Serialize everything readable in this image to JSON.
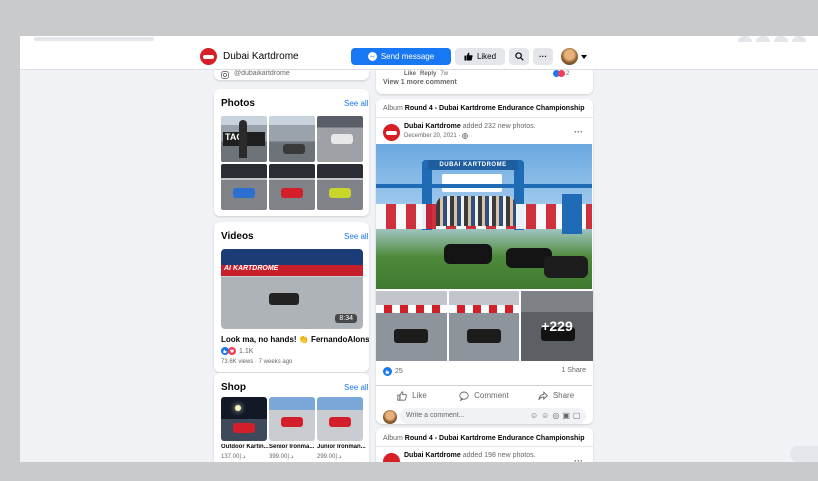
{
  "page": {
    "name": "Dubai Kartdrome",
    "send_message": "Send message",
    "liked": "Liked"
  },
  "left": {
    "instagram_handle": "@dubaikartdrome",
    "photos": {
      "title": "Photos",
      "see_all": "See all"
    },
    "videos": {
      "title": "Videos",
      "see_all": "See all",
      "duration": "8:34",
      "banner": "AI KARTDROME",
      "caption": "Look ma, no hands! 👏 FernandoAlonso...",
      "reaction_count": "1.1K",
      "meta": "73.6K views · 7 weeks ago"
    },
    "shop": {
      "title": "Shop",
      "see_all": "See all",
      "items": [
        {
          "name": "Outdoor Kartin...",
          "price": "137.00د.إ"
        },
        {
          "name": "Senior Ironma...",
          "price": "399.00د.إ"
        },
        {
          "name": "Junior Ironman...",
          "price": "299.00د.إ"
        }
      ]
    }
  },
  "feed": {
    "prev_comment": {
      "like": "Like",
      "reply": "Reply",
      "age": "7w",
      "reactions": "2",
      "view_more": "View 1 more comment"
    },
    "post1": {
      "album_prefix": "Album",
      "album_name": "Round 4 - Dubai Kartdrome Endurance Championship",
      "author": "Dubai Kartdrome",
      "action": "added 232 new photos.",
      "date": "December 20, 2021 · ",
      "arch_text": "DUBAI KARTDROME",
      "more_count": "+229",
      "reactions": "25",
      "shares": "1 Share",
      "like": "Like",
      "comment": "Comment",
      "share": "Share",
      "comment_placeholder": "Write a comment..."
    },
    "post2": {
      "album_prefix": "Album",
      "album_name": "Round 4 - Dubai Kartdrome Endurance Championship",
      "author": "Dubai Kartdrome",
      "action": "added 198 new photos."
    }
  },
  "colors": {
    "accent": "#1877f2",
    "brand": "#d71f26"
  }
}
